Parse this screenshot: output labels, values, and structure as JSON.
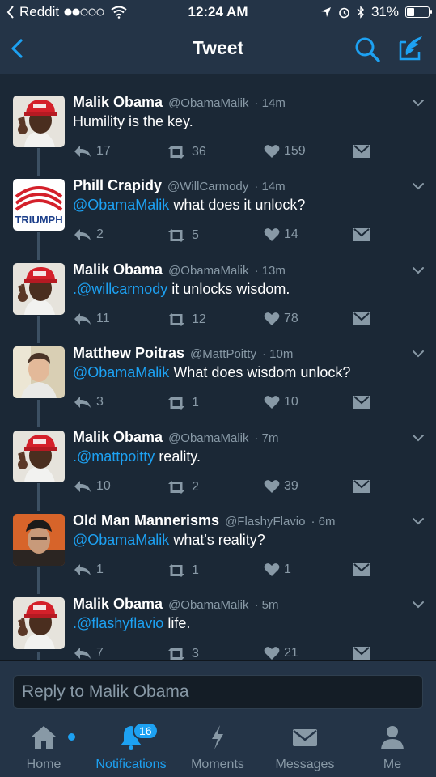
{
  "status_bar": {
    "carrier": "Reddit",
    "time": "12:24 AM",
    "battery": "31%",
    "battery_level": 0.31
  },
  "header": {
    "title": "Tweet"
  },
  "tweets": [
    {
      "name": "Malik Obama",
      "handle": "@ObamaMalik",
      "time": "· 14m",
      "mention": "",
      "text": "Humility is the key.",
      "replies": "17",
      "retweets": "36",
      "likes": "159",
      "avatar": "red-hat-man"
    },
    {
      "name": "Phill Crapidy",
      "handle": "@WillCarmody",
      "time": "· 14m",
      "mention": "@ObamaMalik",
      "text": " what does it unlock?",
      "replies": "2",
      "retweets": "5",
      "likes": "14",
      "avatar": "triumph-logo",
      "avatar_text": "TRIUMPH"
    },
    {
      "name": "Malik Obama",
      "handle": "@ObamaMalik",
      "time": "· 13m",
      "mention": ".@willcarmody",
      "text": " it unlocks wisdom.",
      "replies": "11",
      "retweets": "12",
      "likes": "78",
      "avatar": "red-hat-man"
    },
    {
      "name": "Matthew Poitras",
      "handle": "@MattPoitty",
      "time": "· 10m",
      "mention": "@ObamaMalik",
      "text": " What does wisdom unlock?",
      "replies": "3",
      "retweets": "1",
      "likes": "10",
      "avatar": "young-man"
    },
    {
      "name": "Malik Obama",
      "handle": "@ObamaMalik",
      "time": "· 7m",
      "mention": ".@mattpoitty",
      "text": " reality.",
      "replies": "10",
      "retweets": "2",
      "likes": "39",
      "avatar": "red-hat-man"
    },
    {
      "name": "Old Man Mannerisms",
      "handle": "@FlashyFlavio",
      "time": "· 6m",
      "mention": "@ObamaMalik",
      "text": " what's reality?",
      "replies": "1",
      "retweets": "1",
      "likes": "1",
      "avatar": "orange-bg-man"
    },
    {
      "name": "Malik Obama",
      "handle": "@ObamaMalik",
      "time": "· 5m",
      "mention": ".@flashyflavio",
      "text": " life.",
      "replies": "7",
      "retweets": "3",
      "likes": "21",
      "avatar": "red-hat-man"
    }
  ],
  "reply_box": {
    "placeholder": "Reply to Malik Obama"
  },
  "tabs": [
    {
      "label": "Home",
      "icon": "home-icon"
    },
    {
      "label": "Notifications",
      "icon": "bell-icon",
      "badge": "16"
    },
    {
      "label": "Moments",
      "icon": "lightning-icon"
    },
    {
      "label": "Messages",
      "icon": "envelope-icon"
    },
    {
      "label": "Me",
      "icon": "person-icon"
    }
  ],
  "colors": {
    "accent": "#1da1f2",
    "background": "#1b2836",
    "bar": "#243447",
    "muted": "#8899a6"
  }
}
